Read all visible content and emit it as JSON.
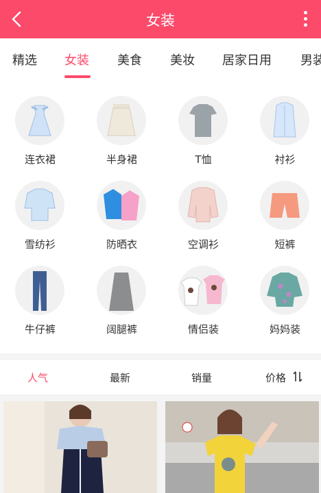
{
  "header": {
    "title": "女装",
    "back_icon": "chevron-left-icon",
    "more_icon": "more-vertical-icon"
  },
  "tabs": [
    {
      "label": "精选"
    },
    {
      "label": "女装",
      "active": true
    },
    {
      "label": "美食"
    },
    {
      "label": "美妆"
    },
    {
      "label": "居家日用"
    },
    {
      "label": "男装"
    }
  ],
  "categories": [
    {
      "label": "连衣裙",
      "icon": "dress-icon"
    },
    {
      "label": "半身裙",
      "icon": "skirt-icon"
    },
    {
      "label": "T恤",
      "icon": "tshirt-icon"
    },
    {
      "label": "衬衫",
      "icon": "shirt-icon"
    },
    {
      "label": "雪纺衫",
      "icon": "chiffon-blouse-icon"
    },
    {
      "label": "防晒衣",
      "icon": "sun-protection-jacket-icon"
    },
    {
      "label": "空调衫",
      "icon": "cardigan-icon"
    },
    {
      "label": "短裤",
      "icon": "shorts-icon"
    },
    {
      "label": "牛仔裤",
      "icon": "jeans-icon"
    },
    {
      "label": "阔腿裤",
      "icon": "wide-leg-pants-icon"
    },
    {
      "label": "情侣装",
      "icon": "couple-tshirts-icon"
    },
    {
      "label": "妈妈装",
      "icon": "mom-blouse-icon"
    }
  ],
  "sort": [
    {
      "label": "人气",
      "active": true
    },
    {
      "label": "最新"
    },
    {
      "label": "销量"
    },
    {
      "label": "价格"
    }
  ],
  "colors": {
    "accent": "#fb4a6a"
  }
}
